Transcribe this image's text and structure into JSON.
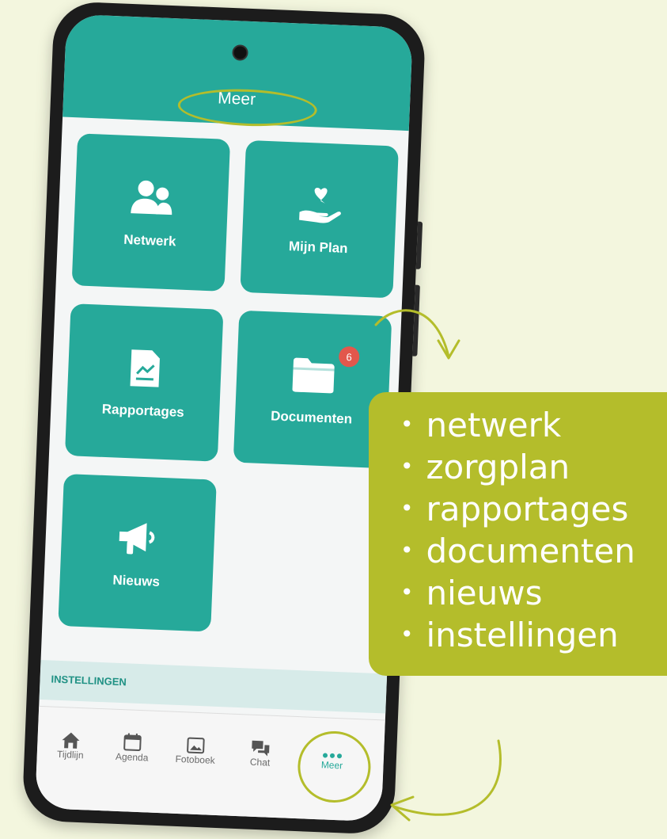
{
  "header": {
    "title": "Meer"
  },
  "tiles": [
    {
      "label": "Netwerk",
      "icon": "users-icon"
    },
    {
      "label": "Mijn Plan",
      "icon": "heart-hand-icon"
    },
    {
      "label": "Rapportages",
      "icon": "report-chart-icon"
    },
    {
      "label": "Documenten",
      "icon": "folder-icon",
      "badge": "6"
    },
    {
      "label": "Nieuws",
      "icon": "megaphone-icon"
    }
  ],
  "section": {
    "title": "INSTELLINGEN"
  },
  "tabbar": {
    "items": [
      {
        "label": "Tijdlijn",
        "icon": "home-icon"
      },
      {
        "label": "Agenda",
        "icon": "calendar-icon"
      },
      {
        "label": "Fotoboek",
        "icon": "image-icon"
      },
      {
        "label": "Chat",
        "icon": "chat-icon"
      },
      {
        "label": "Meer",
        "icon": "more-dots-icon",
        "active": true
      }
    ]
  },
  "callout": {
    "items": [
      "netwerk",
      "zorgplan",
      "rapportages",
      "documenten",
      "nieuws",
      "instellingen"
    ]
  },
  "colors": {
    "teal": "#26a99a",
    "olive": "#b4bd2b",
    "background": "#f3f6de",
    "badge": "#e2574c"
  }
}
